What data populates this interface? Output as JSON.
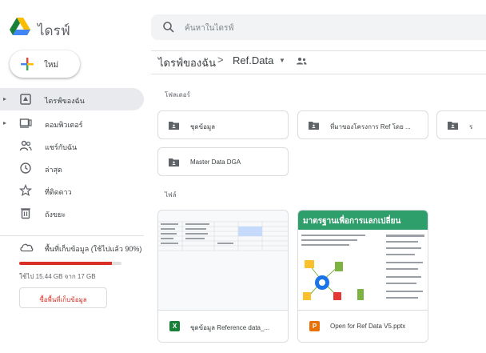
{
  "app": {
    "title": "ไดรฟ์"
  },
  "search": {
    "placeholder": "ค้นหาในไดรฟ์"
  },
  "sidebar": {
    "new_label": "ใหม่",
    "items": [
      {
        "label": "ไดรฟ์ของฉัน",
        "icon": "my-drive-icon",
        "active": true
      },
      {
        "label": "คอมพิวเตอร์",
        "icon": "computer-icon"
      },
      {
        "label": "แชร์กับฉัน",
        "icon": "shared-people-icon"
      },
      {
        "label": "ล่าสุด",
        "icon": "clock-icon"
      },
      {
        "label": "ที่ติดดาว",
        "icon": "star-icon"
      },
      {
        "label": "ถังขยะ",
        "icon": "trash-icon"
      }
    ],
    "storage": {
      "label": "พื้นที่เก็บข้อมูล (ใช้ไปแล้ว 90%)",
      "used_text": "ใช้ไป 15.44 GB จาก 17 GB",
      "used_fraction": 0.908,
      "buy_label": "ซื้อพื้นที่เก็บข้อมูล"
    }
  },
  "breadcrumb": {
    "root": "ไดรฟ์ของฉัน",
    "separator": ">",
    "current": "Ref.Data"
  },
  "sections": {
    "folders": "โฟลเดอร์",
    "files": "ไฟล์"
  },
  "folders": [
    {
      "name": "ชุดข้อมูล"
    },
    {
      "name": "ที่มาของโครงการ Ref โดย ..."
    },
    {
      "name": "ร"
    },
    {
      "name": "Master Data DGA"
    }
  ],
  "files": [
    {
      "name": "ชุดข้อมูล Reference data_...",
      "type_letter": "X",
      "type_color": "#188038",
      "type_icon": "sheets-icon"
    },
    {
      "name": "Open for Ref Data V5.pptx",
      "type_letter": "P",
      "type_color": "#e8710a",
      "type_icon": "slides-icon",
      "thumb_title": "มาตรฐานเพื่อการแลกเปลี่ยน"
    }
  ],
  "colors": {
    "accent_red": "#d93025",
    "slides_green": "#2e9e6b",
    "active_bg": "#e8eaed"
  }
}
